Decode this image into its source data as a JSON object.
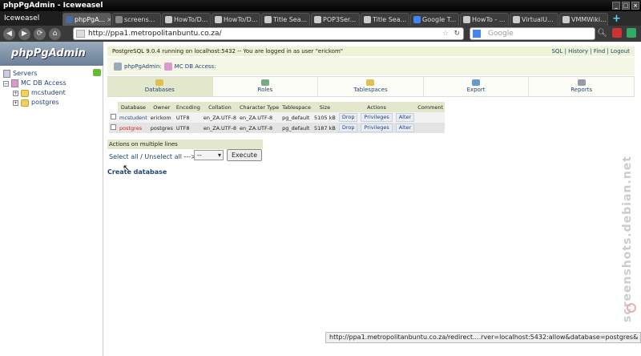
{
  "window": {
    "title": "phpPgAdmin - Iceweasel"
  },
  "browser": {
    "app_title": "Iceweasel",
    "tabs": [
      {
        "label": "phpPgA...",
        "active": true,
        "fav": "#4a6aa5"
      },
      {
        "label": "screens...",
        "active": false,
        "fav": "#888"
      },
      {
        "label": "HowTo/D...",
        "active": false,
        "fav": "#ccc"
      },
      {
        "label": "HowTo/D...",
        "active": false,
        "fav": "#ccc"
      },
      {
        "label": "Title Sea...",
        "active": false,
        "fav": "#ccc"
      },
      {
        "label": "POP3Ser...",
        "active": false,
        "fav": "#ccc"
      },
      {
        "label": "Title Sea...",
        "active": false,
        "fav": "#ccc"
      },
      {
        "label": "Google T...",
        "active": false,
        "fav": "#4285f4"
      },
      {
        "label": "HowTo - ...",
        "active": false,
        "fav": "#ccc"
      },
      {
        "label": "VirtualU...",
        "active": false,
        "fav": "#ccc"
      },
      {
        "label": "VMMWiki...",
        "active": false,
        "fav": "#ccc"
      }
    ],
    "new_tab": "+",
    "url": "http://ppa1.metropolitanbuntu.co.za/",
    "search_placeholder": "Google"
  },
  "sidebar": {
    "logo": "phpPgAdmin",
    "servers": "Servers",
    "server_name": "MC DB Access",
    "databases": [
      "mcstudent",
      "postgres"
    ]
  },
  "main": {
    "info": "PostgreSQL 9.0.4 running on localhost:5432 -- You are logged in as user \"erickom\"",
    "links": [
      "SQL",
      "History",
      "Find",
      "Logout"
    ],
    "trail": {
      "root": "phpPgAdmin:",
      "server": "MC DB Access:"
    },
    "tabs": [
      "Databases",
      "Roles",
      "Tablespaces",
      "Export",
      "Reports"
    ],
    "table": {
      "headers": [
        "Database",
        "Owner",
        "Encoding",
        "Collation",
        "Character Type",
        "Tablespace",
        "Size",
        "Actions",
        "Comment"
      ],
      "rows": [
        {
          "name": "mcstudent",
          "owner": "erickom",
          "encoding": "UTF8",
          "collation": "en_ZA.UTF-8",
          "ctype": "en_ZA.UTF-8",
          "tablespace": "pg_default",
          "size": "5105 kB"
        },
        {
          "name": "postgres",
          "owner": "postgres",
          "encoding": "UTF8",
          "collation": "en_ZA.UTF-8",
          "ctype": "en_ZA.UTF-8",
          "tablespace": "pg_default",
          "size": "5187 kB"
        }
      ],
      "actions": [
        "Drop",
        "Privileges",
        "Alter"
      ]
    },
    "multi_label": "Actions on multiple lines",
    "select_all": "Select all",
    "separator": " / ",
    "unselect_all": "Unselect all",
    "arrow": "--->",
    "select_value": "--",
    "execute": "Execute",
    "create_db": "Create database"
  },
  "status_bar": "http://ppa1.metropolitanbuntu.co.za/redirect....rver=localhost:5432:allow&database=postgres&",
  "watermark": "screenshots.debian.net"
}
